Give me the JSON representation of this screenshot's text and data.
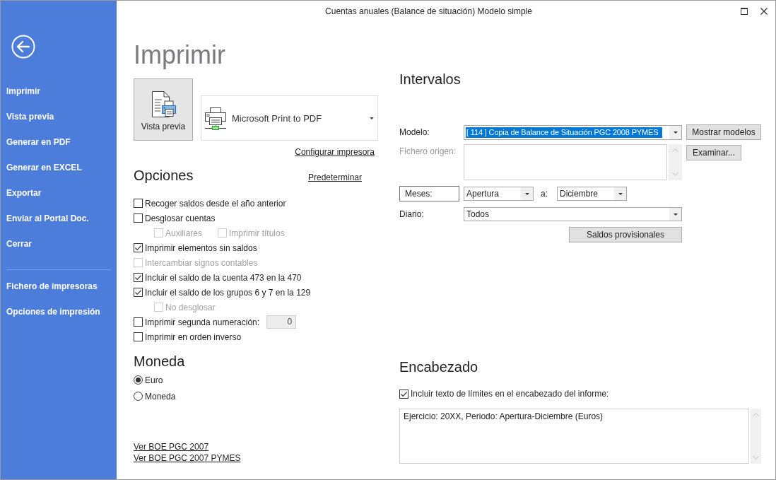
{
  "window": {
    "title": "Cuentas anuales (Balance de situación) Modelo simple"
  },
  "sidebar": {
    "groups": [
      {
        "items": [
          "Imprimir",
          "Vista previa",
          "Generar en PDF",
          "Generar en EXCEL",
          "Exportar",
          "Enviar al Portal Doc.",
          "Cerrar"
        ]
      },
      {
        "items": [
          "Fichero de impresoras",
          "Opciones de impresión"
        ]
      }
    ]
  },
  "page_title": "Imprimir",
  "print": {
    "preview_button": "Vista previa",
    "printer": "Microsoft Print to PDF",
    "configure_link": "Configurar impresora"
  },
  "options": {
    "title": "Opciones",
    "default_link": "Predeterminar",
    "items": [
      {
        "label": "Recoger saldos desde el año anterior",
        "checked": false,
        "disabled": false
      },
      {
        "label": "Desglosar cuentas",
        "checked": false,
        "disabled": false,
        "children": [
          {
            "label": "Auxiliares",
            "checked": false,
            "disabled": true
          },
          {
            "label": "Imprimir títulos",
            "checked": false,
            "disabled": true
          }
        ]
      },
      {
        "label": "Imprimir elementos sin saldos",
        "checked": true,
        "disabled": false
      },
      {
        "label": "Intercambiar signos contables",
        "checked": false,
        "disabled": true
      },
      {
        "label": "Incluir el saldo de la cuenta 473 en la 470",
        "checked": true,
        "disabled": false
      },
      {
        "label": "Incluir el saldo de los grupos 6 y 7 en la 129",
        "checked": true,
        "disabled": false,
        "children": [
          {
            "label": "No desglosar",
            "checked": false,
            "disabled": true
          }
        ]
      },
      {
        "label": "Imprimir segunda numeración:",
        "checked": false,
        "disabled": false,
        "number_field": {
          "value": "0",
          "disabled": true
        }
      },
      {
        "label": "Imprimir en orden inverso",
        "checked": false,
        "disabled": false
      }
    ]
  },
  "currency": {
    "title": "Moneda",
    "options": [
      {
        "label": "Euro",
        "selected": true
      },
      {
        "label": "Moneda",
        "selected": false
      }
    ]
  },
  "links": [
    "Ver BOE PGC 2007",
    "Ver BOE PGC 2007 PYMES"
  ],
  "intervals": {
    "title": "Intervalos",
    "model": {
      "label": "Modelo:",
      "value": "[ 114 ] Copia de Balance de Situación PGC 2008 PYMES",
      "highlighted": true,
      "button": "Mostrar modelos"
    },
    "source_file": {
      "label": "Fichero origen:",
      "disabled": true,
      "button": "Examinar..."
    },
    "months": {
      "label": "Meses:",
      "from": "Apertura",
      "to_label": "a:",
      "to": "Diciembre"
    },
    "journal": {
      "label": "Diario:",
      "value": "Todos"
    },
    "provisional_button": "Saldos provisionales"
  },
  "header": {
    "title": "Encabezado",
    "include_limits": {
      "label": "Incluir texto de límites en el encabezado del informe:",
      "checked": true
    },
    "text": "Ejercicio: 20XX, Periodo: Apertura-Diciembre (Euros)"
  }
}
